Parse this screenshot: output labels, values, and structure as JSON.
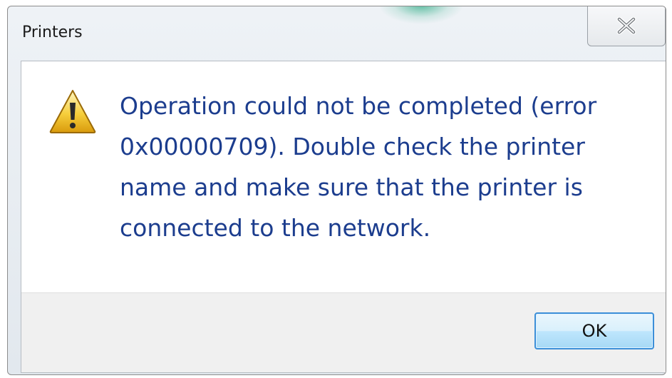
{
  "window": {
    "title": "Printers"
  },
  "dialog": {
    "message_line1": "Operation could not be completed (error",
    "message_line2": "0x00000709). Double check the printer",
    "message_line3": "name and make sure that the printer is",
    "message_line4": "connected to the network.",
    "icon": "warning-icon"
  },
  "buttons": {
    "ok_label": "OK",
    "close_icon": "close-icon"
  },
  "colors": {
    "message_text": "#1c3d8e",
    "ok_border": "#3c8fd8",
    "footer_bg": "#f0f0f0"
  }
}
